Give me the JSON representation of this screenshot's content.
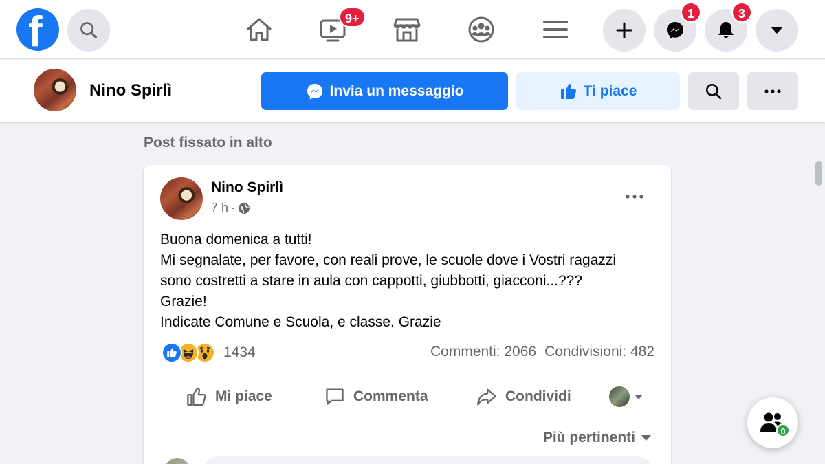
{
  "topbar": {
    "logo_letter": "f",
    "icons": {
      "logo": "facebook-logo",
      "search": "search-icon",
      "home": "home-icon",
      "watch": "video-icon",
      "marketplace": "store-icon",
      "groups": "groups-icon",
      "menu": "menu-icon",
      "create": "plus-icon",
      "messenger": "messenger-icon",
      "notifications": "bell-icon",
      "account": "caret-down-icon"
    },
    "watch_badge": "9+",
    "messenger_badge": "1",
    "notifications_badge": "3"
  },
  "page_header": {
    "name": "Nino Spirlì",
    "message_button": "Invia un messaggio",
    "like_button": "Ti piace"
  },
  "pinned_label": "Post fissato in alto",
  "post": {
    "author": "Nino Spirlì",
    "time": "7 h",
    "separator": "·",
    "text_lines": [
      "Buona domenica a tutti!",
      "Mi segnalate, per favore, con reali prove, le scuole dove i Vostri ragazzi",
      "sono costretti a stare in aula con cappotti, giubbotti, giacconi...???",
      "Grazie!",
      "Indicate Comune e Scuola, e classe. Grazie"
    ],
    "reaction_types": [
      "like",
      "haha",
      "wow"
    ],
    "reactions_count": "1434",
    "comments": "Commenti: 2066",
    "shares": "Condivisioni: 482",
    "actions": {
      "like": "Mi piace",
      "comment": "Commenta",
      "share": "Condividi"
    },
    "sort_label": "Più pertinenti"
  },
  "contacts_fab": {
    "count": "0"
  },
  "colors": {
    "brand_blue": "#1877f2",
    "badge_red": "#e41e3f",
    "online_green": "#31a24c",
    "background": "#f0f2f5"
  }
}
